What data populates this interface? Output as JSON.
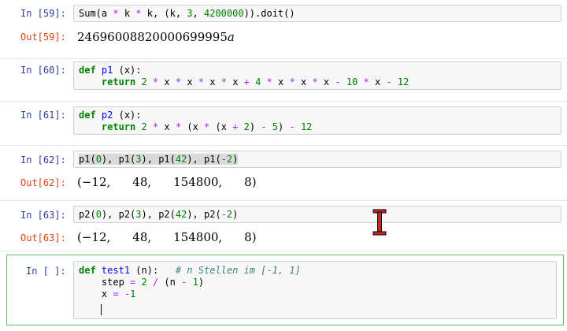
{
  "cells": [
    {
      "in_prompt": "In [59]:",
      "out_prompt": "Out[59]:",
      "code": "Sum(a * k * k, (k, 3, 4200000)).doit()",
      "output_value": "24696008820000699995",
      "output_var": "a"
    },
    {
      "in_prompt": "In [60]:",
      "code_l1": "def p1 (x):",
      "code_l2": "    return 2 * x * x * x * x + 4 * x * x * x - 10 * x - 12"
    },
    {
      "in_prompt": "In [61]:",
      "code_l1": "def p2 (x):",
      "code_l2": "    return 2 * x * (x * (x + 2) - 5) - 12"
    },
    {
      "in_prompt": "In [62]:",
      "out_prompt": "Out[62]:",
      "code": "p1(0), p1(3), p1(42), p1(-2)",
      "output": [
        "(−12,",
        "48,",
        "154800,",
        "8)"
      ]
    },
    {
      "in_prompt": "In [63]:",
      "out_prompt": "Out[63]:",
      "code": "p2(0), p2(3), p2(42), p2(-2)",
      "output": [
        "(−12,",
        "48,",
        "154800,",
        "8)"
      ]
    },
    {
      "in_prompt": "In [ ]:",
      "code_l1": "def test1 (n):   # n Stellen im [-1, 1]",
      "code_l2": "    step = 2 / (n - 1)",
      "code_l3": "    x = -1"
    }
  ],
  "colors": {
    "in_prompt": "#303f9f",
    "out_prompt": "#d84315",
    "active_border": "#66bb6a",
    "keyword": "#008000",
    "function": "#0000ff",
    "operator": "#aa22ff",
    "comment": "#408080"
  },
  "cursor_icon": "text-cursor-ibeam-icon"
}
